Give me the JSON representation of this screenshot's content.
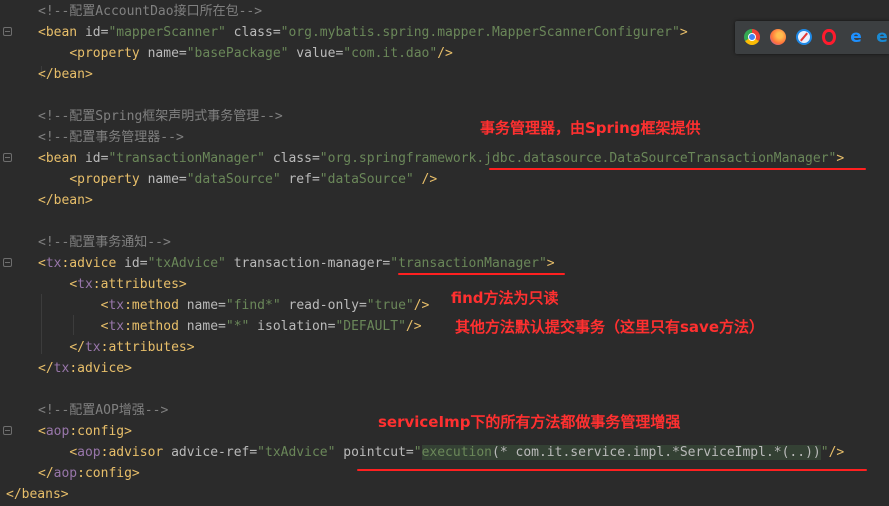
{
  "editor": {
    "lines": [
      [
        {
          "t": "<!--配置AccountDao接口所在包-->",
          "c": "cm"
        }
      ],
      [
        {
          "t": "<",
          "c": "tag"
        },
        {
          "t": "bean ",
          "c": "tag"
        },
        {
          "t": "id=",
          "c": "attr"
        },
        {
          "t": "\"mapperScanner\"",
          "c": "str"
        },
        {
          "t": " class=",
          "c": "attr"
        },
        {
          "t": "\"org.mybatis.spring.mapper.MapperScannerConfigurer\"",
          "c": "str"
        },
        {
          "t": ">",
          "c": "tag"
        }
      ],
      [
        {
          "t": "    "
        },
        {
          "t": "<property ",
          "c": "tag"
        },
        {
          "t": "name=",
          "c": "attr"
        },
        {
          "t": "\"basePackage\"",
          "c": "str"
        },
        {
          "t": " value=",
          "c": "attr"
        },
        {
          "t": "\"com.it.dao\"",
          "c": "str"
        },
        {
          "t": "/>",
          "c": "tag"
        }
      ],
      [
        {
          "t": "</bean>",
          "c": "tag"
        }
      ],
      [],
      [
        {
          "t": "<!--配置Spring框架声明式事务管理-->",
          "c": "cm"
        }
      ],
      [
        {
          "t": "<!--配置事务管理器-->",
          "c": "cm"
        }
      ],
      [
        {
          "t": "<bean ",
          "c": "tag"
        },
        {
          "t": "id=",
          "c": "attr"
        },
        {
          "t": "\"transactionManager\"",
          "c": "str"
        },
        {
          "t": " class=",
          "c": "attr"
        },
        {
          "t": "\"org.springframework.jdbc.datasource.DataSourceTransactionManager\"",
          "c": "str"
        },
        {
          "t": ">",
          "c": "tag"
        }
      ],
      [
        {
          "t": "    "
        },
        {
          "t": "<property ",
          "c": "tag"
        },
        {
          "t": "name=",
          "c": "attr"
        },
        {
          "t": "\"dataSource\"",
          "c": "str"
        },
        {
          "t": " ref=",
          "c": "attr"
        },
        {
          "t": "\"dataSource\"",
          "c": "str"
        },
        {
          "t": " />",
          "c": "tag"
        }
      ],
      [
        {
          "t": "</bean>",
          "c": "tag"
        }
      ],
      [],
      [
        {
          "t": "<!--配置事务通知-->",
          "c": "cm"
        }
      ],
      [
        {
          "t": "<",
          "c": "tag"
        },
        {
          "t": "tx",
          "c": "ns"
        },
        {
          "t": ":advice ",
          "c": "tag"
        },
        {
          "t": "id=",
          "c": "attr"
        },
        {
          "t": "\"txAdvice\"",
          "c": "str"
        },
        {
          "t": " transaction-manager=",
          "c": "attr"
        },
        {
          "t": "\"transactionManager\"",
          "c": "str"
        },
        {
          "t": ">",
          "c": "tag"
        }
      ],
      [
        {
          "t": "    "
        },
        {
          "t": "<",
          "c": "tag"
        },
        {
          "t": "tx",
          "c": "ns"
        },
        {
          "t": ":attributes>",
          "c": "tag"
        }
      ],
      [
        {
          "t": "        "
        },
        {
          "t": "<",
          "c": "tag"
        },
        {
          "t": "tx",
          "c": "ns"
        },
        {
          "t": ":method ",
          "c": "tag"
        },
        {
          "t": "name=",
          "c": "attr"
        },
        {
          "t": "\"find*\"",
          "c": "str"
        },
        {
          "t": " read-only=",
          "c": "attr"
        },
        {
          "t": "\"true\"",
          "c": "str"
        },
        {
          "t": "/>",
          "c": "tag"
        }
      ],
      [
        {
          "t": "        "
        },
        {
          "t": "<",
          "c": "tag"
        },
        {
          "t": "tx",
          "c": "ns"
        },
        {
          "t": ":method ",
          "c": "tag"
        },
        {
          "t": "name=",
          "c": "attr"
        },
        {
          "t": "\"*\"",
          "c": "str"
        },
        {
          "t": " isolation=",
          "c": "attr"
        },
        {
          "t": "\"DEFAULT\"",
          "c": "str"
        },
        {
          "t": "/>",
          "c": "tag"
        }
      ],
      [
        {
          "t": "    "
        },
        {
          "t": "</",
          "c": "tag"
        },
        {
          "t": "tx",
          "c": "ns"
        },
        {
          "t": ":attributes>",
          "c": "tag"
        }
      ],
      [
        {
          "t": "</",
          "c": "tag"
        },
        {
          "t": "tx",
          "c": "ns"
        },
        {
          "t": ":advice>",
          "c": "tag"
        }
      ],
      [],
      [
        {
          "t": "<!--配置AOP增强-->",
          "c": "cm"
        }
      ],
      [
        {
          "t": "<",
          "c": "tag"
        },
        {
          "t": "aop",
          "c": "ns"
        },
        {
          "t": ":config>",
          "c": "tag"
        }
      ],
      [
        {
          "t": "    "
        },
        {
          "t": "<",
          "c": "tag"
        },
        {
          "t": "aop",
          "c": "ns"
        },
        {
          "t": ":advisor ",
          "c": "tag"
        },
        {
          "t": "advice-ref=",
          "c": "attr"
        },
        {
          "t": "\"txAdvice\"",
          "c": "str"
        },
        {
          "t": " pointcut=",
          "c": "attr"
        },
        {
          "t": "\"",
          "c": "str"
        },
        {
          "t": "execution",
          "c": "str hl"
        },
        {
          "t": "(* com.it.service.impl.*ServiceImpl.*(..))",
          "c": "attr hl"
        },
        {
          "t": "\"",
          "c": "str"
        },
        {
          "t": "/>",
          "c": "tag"
        }
      ],
      [
        {
          "t": "</",
          "c": "tag"
        },
        {
          "t": "aop",
          "c": "ns"
        },
        {
          "t": ":config>",
          "c": "tag"
        }
      ],
      [
        {
          "t": "</beans>",
          "c": "tag"
        }
      ]
    ]
  },
  "annotations": {
    "tx_manager": "事务管理器，由Spring框架提供",
    "find_readonly": "find方法为只读",
    "other_methods": "其他方法默认提交事务（这里只有save方法）",
    "service_imp": "serviceImp下的所有方法都做事务管理增强"
  },
  "browser_bar": {
    "icons": [
      "chrome-icon",
      "firefox-icon",
      "safari-icon",
      "opera-icon",
      "ie-icon",
      "edge-icon"
    ],
    "colors": [
      "#4285f4",
      "#ff7139",
      "#1e88e5",
      "#ff1b2d",
      "#1e90ff",
      "#1a8ad4"
    ]
  }
}
